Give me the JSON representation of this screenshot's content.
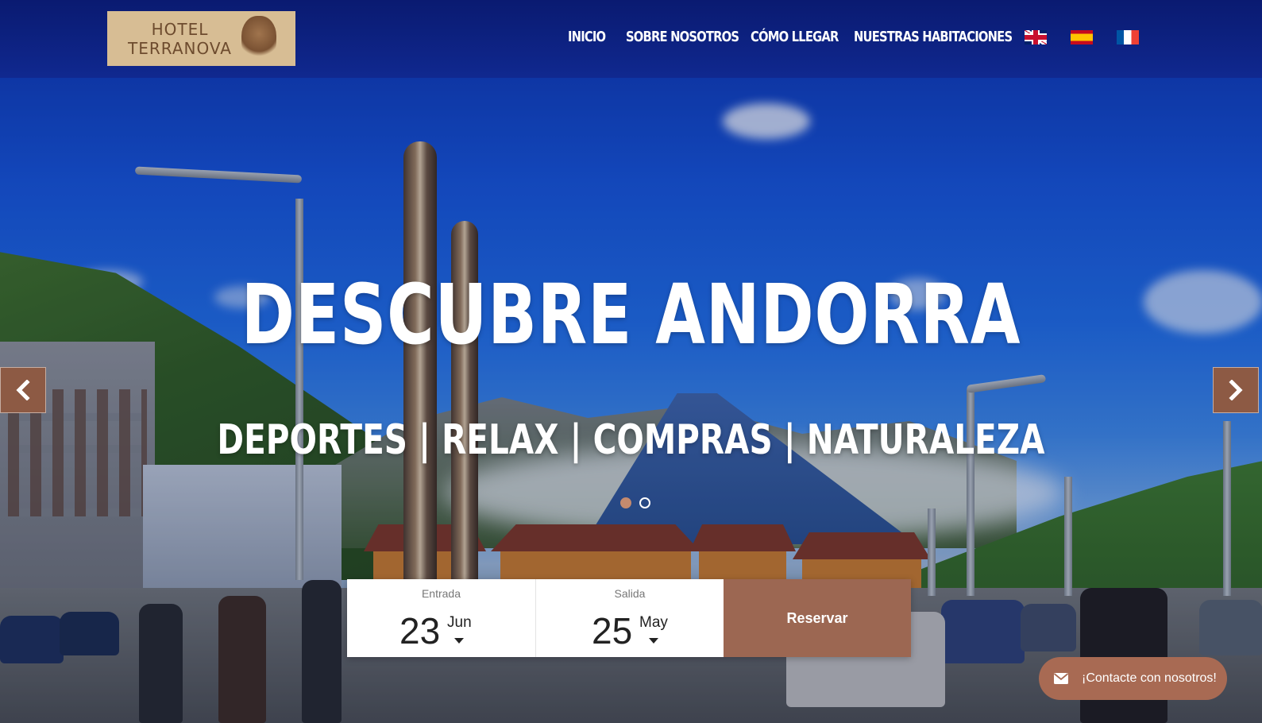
{
  "brand": {
    "logo_text": "HOTEL\nTERRANOVA",
    "logo_bg": "#d7bd94",
    "logo_text_color": "#6d4b2e",
    "accent": "#9c6752"
  },
  "nav": {
    "items": [
      {
        "label": "INICIO"
      },
      {
        "label": "SOBRE NOSOTROS"
      },
      {
        "label": "CÓMO LLEGAR"
      },
      {
        "label": "NUESTRAS HABITACIONES"
      }
    ],
    "languages": [
      {
        "icon": "uk-flag-icon"
      },
      {
        "icon": "spain-flag-icon"
      },
      {
        "icon": "france-flag-icon"
      }
    ]
  },
  "hero": {
    "title": "DESCUBRE ANDORRA",
    "subtitle": "DEPORTES | RELAX | COMPRAS | NATURALEZA",
    "prev_icon": "chevron-left-icon",
    "next_icon": "chevron-right-icon",
    "slides_count": 2,
    "active_slide": 1
  },
  "booking": {
    "checkin": {
      "label": "Entrada",
      "day": "23",
      "month": "Jun"
    },
    "checkout": {
      "label": "Salida",
      "day": "25",
      "month": "May"
    },
    "button_label": "Reservar"
  },
  "contact": {
    "label": "¡Contacte con nosotros!",
    "icon": "envelope-icon"
  }
}
